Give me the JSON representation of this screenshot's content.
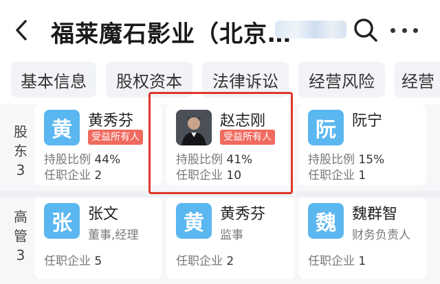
{
  "header": {
    "title": "福莱魔石影业（北京…",
    "back_icon": "back-arrow-icon",
    "search_icon": "search-icon",
    "more_icon": "more-icon"
  },
  "tabs": [
    {
      "label": "基本信息"
    },
    {
      "label": "股权资本"
    },
    {
      "label": "法律诉讼"
    },
    {
      "label": "经营风险"
    },
    {
      "label": "经营"
    }
  ],
  "shareholders": {
    "label": "股\n东\n3",
    "cards": [
      {
        "avatar_char": "黄",
        "avatar_color": "#5bb7f0",
        "name": "黄秀芬",
        "badge": "受益所有人",
        "ratio_label": "持股比例",
        "ratio": "44%",
        "jobs_label": "任职企业",
        "jobs": "2"
      },
      {
        "avatar_char": "",
        "avatar_color": "#3b3f46",
        "name": "赵志刚",
        "badge": "受益所有人",
        "ratio_label": "持股比例",
        "ratio": "41%",
        "jobs_label": "任职企业",
        "jobs": "10"
      },
      {
        "avatar_char": "阮",
        "avatar_color": "#5bb7f0",
        "name": "阮宁",
        "badge": "",
        "ratio_label": "持股比例",
        "ratio": "15%",
        "jobs_label": "任职企业",
        "jobs": "1"
      }
    ]
  },
  "executives": {
    "label": "高\n管\n3",
    "cards": [
      {
        "avatar_char": "张",
        "avatar_color": "#5bb7f0",
        "name": "张文",
        "role": "董事,经理",
        "jobs_label": "任职企业",
        "jobs": "5"
      },
      {
        "avatar_char": "黄",
        "avatar_color": "#5bb7f0",
        "name": "黄秀芬",
        "role": "监事",
        "jobs_label": "任职企业",
        "jobs": "2"
      },
      {
        "avatar_char": "魏",
        "avatar_color": "#5bb7f0",
        "name": "魏群智",
        "role": "财务负责人",
        "jobs_label": "任职企业",
        "jobs": "1"
      }
    ]
  },
  "colors": {
    "badge": "#f06a5f",
    "highlight": "#e0352b",
    "avatar_blue": "#5bb7f0"
  }
}
